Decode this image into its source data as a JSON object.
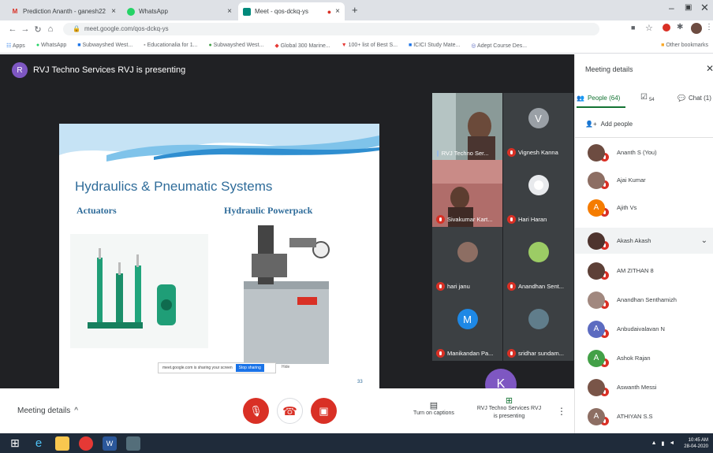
{
  "browser": {
    "tabs": [
      {
        "label": "Prediction Ananth - ganesh22",
        "icon_color": "#d93025",
        "icon_letter": "M"
      },
      {
        "label": "WhatsApp",
        "icon_color": "#25d366",
        "icon_letter": ""
      },
      {
        "label": "Meet - qos-dckq-ys",
        "icon_color": "#00897b",
        "icon_letter": ""
      }
    ],
    "url": "meet.google.com/qos-dckq-ys",
    "bookmarks": [
      "Apps",
      "WhatsApp",
      "Subwayshed West...",
      "Educationalia for 1...",
      "Subwayshed West...",
      "Global 300 Marine...",
      "100+ list of Best S...",
      "ICICI Study Mate...",
      "Adept Course Des...",
      "Other bookmarks"
    ]
  },
  "meeting": {
    "presenter_initial": "R",
    "presenter_text": "RVJ Techno Services RVJ is presenting",
    "slide": {
      "title": "Hydraulics & Pneumatic Systems",
      "left_subtitle": "Actuators",
      "right_subtitle": "Hydraulic Powerpack",
      "share_text": "meet.google.com is sharing your screen",
      "share_button": "Stop sharing",
      "hide_text": "Hide",
      "page_number": "33"
    },
    "tiles": [
      {
        "name": "RVJ Techno Ser...",
        "type": "video"
      },
      {
        "name": "Vignesh Kanna",
        "initial": "V",
        "color": "#9aa0a6"
      },
      {
        "name": "Sivakumar Kart...",
        "type": "video"
      },
      {
        "name": "Hari Haran",
        "type": "avatar-light"
      },
      {
        "name": "hari janu",
        "type": "photo"
      },
      {
        "name": "Anandhan Sent...",
        "type": "photo"
      },
      {
        "name": "Manikandan Pa...",
        "initial": "M",
        "color": "#1e88e5"
      },
      {
        "name": "sridhar sundam...",
        "type": "photo"
      }
    ],
    "overflow_initial": "K",
    "controls": {
      "meeting_details": "Meeting details",
      "captions": "Turn on captions",
      "presenting_line1": "RVJ Techno Services RVJ",
      "presenting_line2": "is presenting"
    }
  },
  "panel": {
    "title": "Meeting details",
    "tab_people": "People (64)",
    "tab_chat_count": "54",
    "tab_chat": "Chat (1)",
    "add_people": "Add people",
    "participants": [
      {
        "name": "Ananth S (You)",
        "initial": "",
        "color": "#6d4c41"
      },
      {
        "name": "Ajai Kumar",
        "initial": "",
        "color": "#8d6e63"
      },
      {
        "name": "Ajith Vs",
        "initial": "A",
        "color": "#f57c00"
      },
      {
        "name": "Akash Akash",
        "initial": "",
        "color": "#4e342e"
      },
      {
        "name": "AM ZITHAN 8",
        "initial": "",
        "color": "#5d4037"
      },
      {
        "name": "Anandhan Senthamizh",
        "initial": "",
        "color": "#a1887f"
      },
      {
        "name": "Anbudaivalavan N",
        "initial": "A",
        "color": "#5c6bc0"
      },
      {
        "name": "Ashok Rajan",
        "initial": "A",
        "color": "#43a047"
      },
      {
        "name": "Aswanth Messi",
        "initial": "",
        "color": "#795548"
      },
      {
        "name": "ATHIYAN S.S",
        "initial": "A",
        "color": "#8d6e63"
      }
    ]
  },
  "taskbar": {
    "time": "10:45 AM",
    "date": "28-04-2020"
  }
}
